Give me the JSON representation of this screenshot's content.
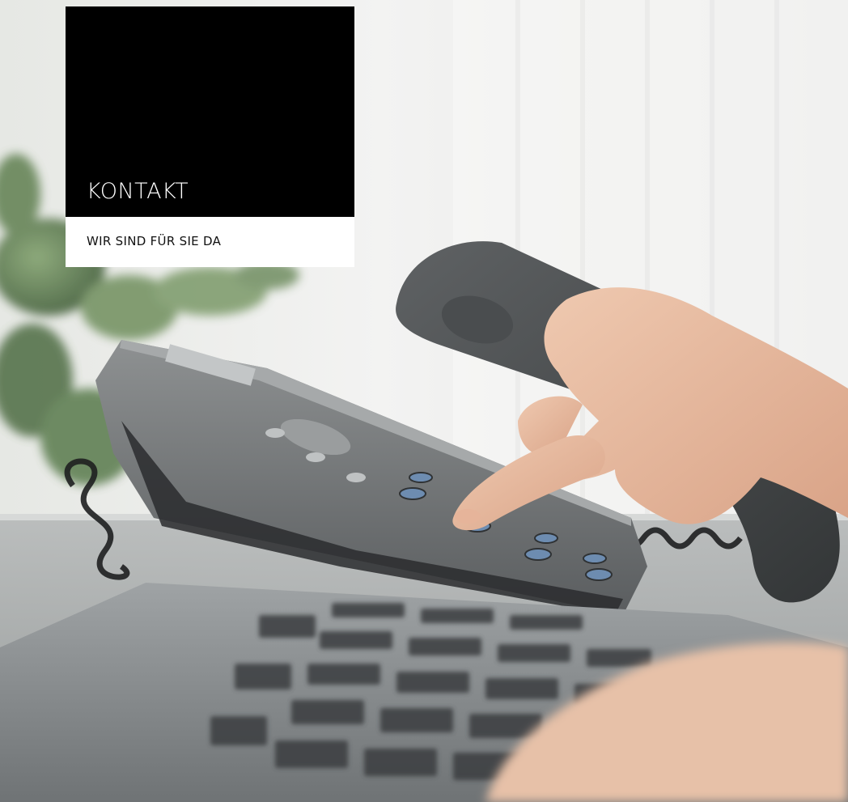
{
  "hero": {
    "title": "KONTAKT",
    "subtitle": "WIR SIND FÜR SIE DA",
    "image_icon": "photo-telephone-icon"
  }
}
